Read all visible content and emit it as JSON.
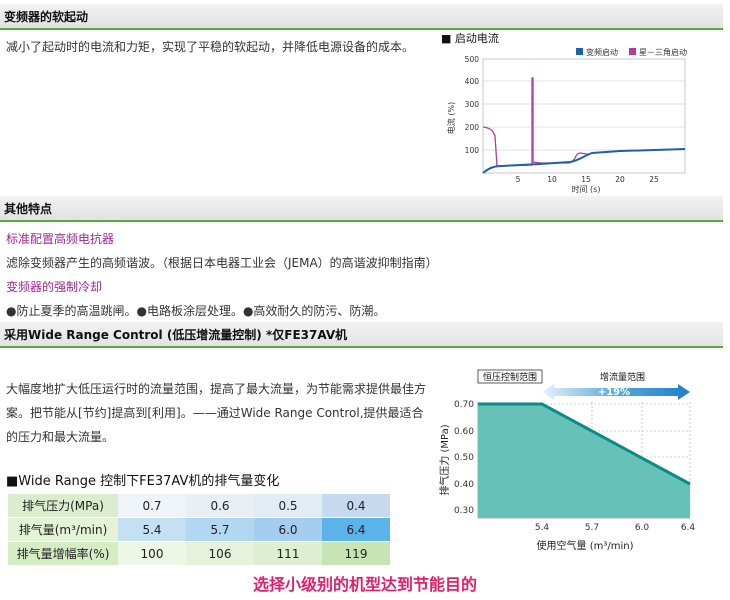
{
  "sec1": {
    "title": "变频器的软起动",
    "desc": "减小了起动时的电流和力矩，实现了平稳的软起动，并降低电源设备的成本。"
  },
  "chart1": {
    "title": "■ 启动电流",
    "legend": [
      {
        "name": "变频启动",
        "color": "#1e5fae"
      },
      {
        "name": "星－三角启动",
        "color": "#b43c9c"
      }
    ],
    "ylabel": "电流 (%)",
    "xlabel": "时间 (s)",
    "yticks": [
      "500",
      "400",
      "300",
      "200",
      "100"
    ],
    "xticks": [
      "5",
      "10",
      "15",
      "20",
      "25"
    ]
  },
  "sec2": {
    "title": "其他特点",
    "sub1": "标准配置高频电抗器",
    "line1": "滤除变频器产生的高频谐波。（根据日本电器工业会（JEMA）的高谐波抑制指南）",
    "sub2": "变频器的强制冷却",
    "line2": "●防止夏季的高温跳闸。●电路板涂层处理。●高效耐久的防污、防潮。"
  },
  "sec3": {
    "title": "采用Wide Range Control (低压增流量控制) *仅FE37AV机",
    "para1": "大幅度地扩大低压运行时的流量范围，提高了最大流量，为节能需求提供最佳方",
    "para2": "案。把节能从[节约]提高到[利用]。——通过Wide Range Control,提供最适合",
    "para3": "的压力和最大流量。",
    "table_title": "■Wide Range 控制下FE37AV机的排气量变化"
  },
  "table": {
    "rows": [
      {
        "label": "排气压力(MPa)",
        "values": [
          "0.7",
          "0.6",
          "0.5",
          "0.4"
        ]
      },
      {
        "label": "排气量(m³/min)",
        "values": [
          "5.4",
          "5.7",
          "6.0",
          "6.4"
        ]
      },
      {
        "label": "排气量增幅率(%)",
        "values": [
          "100",
          "106",
          "111",
          "119"
        ]
      }
    ]
  },
  "chart2": {
    "label_left": "恒压控制范围",
    "label_right": "增流量范围",
    "arrow_text": "+19%",
    "ylabel": "排气压力 (MPa)",
    "xlabel": "使用空气量 (m³/min)",
    "yticks": [
      "0.70",
      "0.60",
      "0.50",
      "0.40",
      "0.30"
    ],
    "xticks": [
      "5.4",
      "5.7",
      "6.0",
      "6.4"
    ]
  },
  "bottom_note": "选择小级别的机型达到节能目的"
}
